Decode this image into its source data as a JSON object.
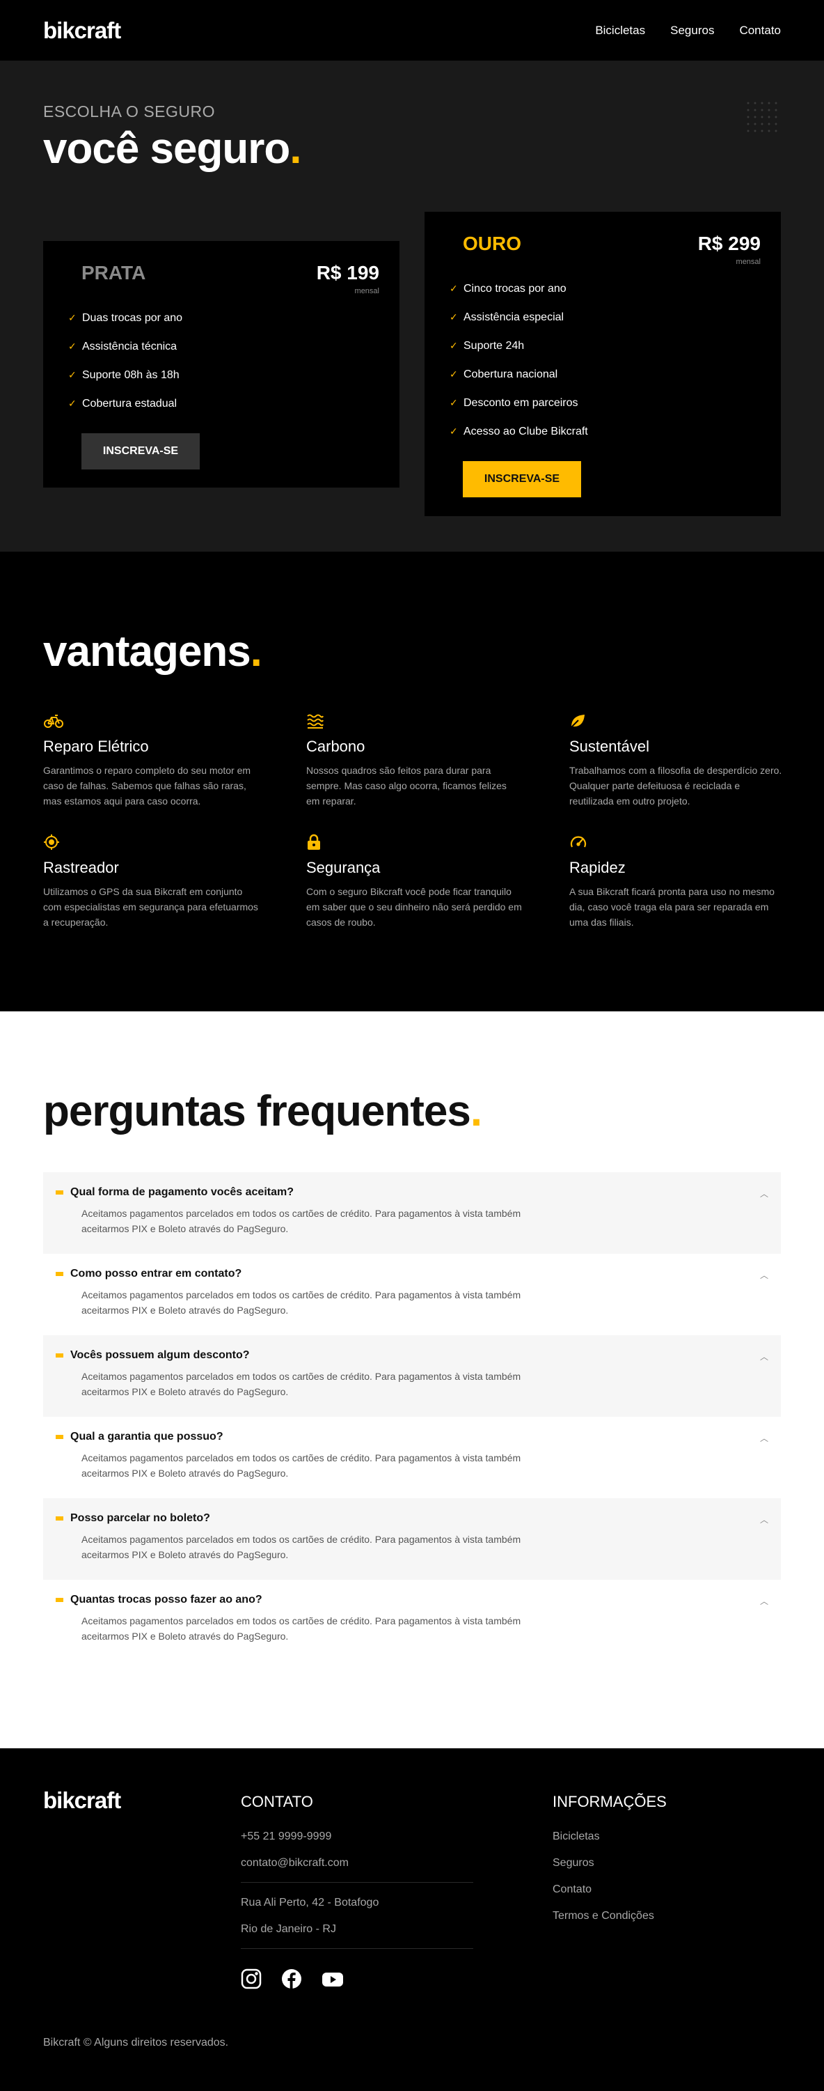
{
  "header": {
    "logo": "bikcraft",
    "nav": [
      "Bicicletas",
      "Seguros",
      "Contato"
    ]
  },
  "hero": {
    "eyebrow": "ESCOLHA O SEGURO",
    "title": "você seguro",
    "title_dot": ".",
    "plans": [
      {
        "name": "PRATA",
        "price": "R$ 199",
        "period": "mensal",
        "features": [
          "Duas trocas por ano",
          "Assistência técnica",
          "Suporte 08h às 18h",
          "Cobertura estadual"
        ],
        "button": "INSCREVA-SE"
      },
      {
        "name": "OURO",
        "price": "R$ 299",
        "period": "mensal",
        "features": [
          "Cinco trocas por ano",
          "Assistência especial",
          "Suporte 24h",
          "Cobertura nacional",
          "Desconto em parceiros",
          "Acesso ao Clube Bikcraft"
        ],
        "button": "INSCREVA-SE"
      }
    ]
  },
  "advantages": {
    "title": "vantagens",
    "title_dot": ".",
    "items": [
      {
        "icon": "bike-icon",
        "title": "Reparo Elétrico",
        "text": "Garantimos o reparo completo do seu motor em caso de falhas. Sabemos que falhas são raras, mas estamos aqui para caso ocorra."
      },
      {
        "icon": "waves-icon",
        "title": "Carbono",
        "text": "Nossos quadros são feitos para durar para sempre. Mas caso algo ocorra, ficamos felizes em reparar."
      },
      {
        "icon": "leaf-icon",
        "title": "Sustentável",
        "text": "Trabalhamos com a filosofia de desperdício zero. Qualquer parte defeituosa é reciclada e reutilizada em outro projeto."
      },
      {
        "icon": "target-icon",
        "title": "Rastreador",
        "text": "Utilizamos o GPS da sua Bikcraft em conjunto com especialistas em segurança para efetuarmos a recuperação."
      },
      {
        "icon": "lock-icon",
        "title": "Segurança",
        "text": "Com o seguro Bikcraft você pode ficar tranquilo em saber que o seu dinheiro não será perdido em casos de roubo."
      },
      {
        "icon": "speedometer-icon",
        "title": "Rapidez",
        "text": "A sua Bikcraft ficará pronta para uso no mesmo dia, caso você traga ela para ser reparada em uma das filiais."
      }
    ]
  },
  "faq": {
    "title": "perguntas frequentes",
    "title_dot": ".",
    "items": [
      {
        "q": "Qual forma de pagamento vocês aceitam?",
        "a": "Aceitamos pagamentos parcelados em todos os cartões de crédito. Para pagamentos à vista também aceitarmos PIX e Boleto através do PagSeguro."
      },
      {
        "q": "Como posso entrar em contato?",
        "a": "Aceitamos pagamentos parcelados em todos os cartões de crédito. Para pagamentos à vista também aceitarmos PIX e Boleto através do PagSeguro."
      },
      {
        "q": "Vocês possuem algum desconto?",
        "a": "Aceitamos pagamentos parcelados em todos os cartões de crédito. Para pagamentos à vista também aceitarmos PIX e Boleto através do PagSeguro."
      },
      {
        "q": "Qual a garantia que possuo?",
        "a": "Aceitamos pagamentos parcelados em todos os cartões de crédito. Para pagamentos à vista também aceitarmos PIX e Boleto através do PagSeguro."
      },
      {
        "q": "Posso parcelar no boleto?",
        "a": "Aceitamos pagamentos parcelados em todos os cartões de crédito. Para pagamentos à vista também aceitarmos PIX e Boleto através do PagSeguro."
      },
      {
        "q": "Quantas trocas posso fazer ao ano?",
        "a": "Aceitamos pagamentos parcelados em todos os cartões de crédito. Para pagamentos à vista também aceitarmos PIX e Boleto através do PagSeguro."
      }
    ]
  },
  "footer": {
    "logo": "bikcraft",
    "contact_title": "CONTATO",
    "phone": "+55 21 9999-9999",
    "email": "contato@bikcraft.com",
    "address1": "Rua Ali Perto, 42 - Botafogo",
    "address2": "Rio de Janeiro - RJ",
    "info_title": "INFORMAÇÕES",
    "info_links": [
      "Bicicletas",
      "Seguros",
      "Contato",
      "Termos e Condições"
    ],
    "copyright": "Bikcraft © Alguns direitos reservados."
  },
  "colors": {
    "accent": "#ffbb00",
    "dark": "#000000",
    "panel": "#1a1a1a"
  }
}
